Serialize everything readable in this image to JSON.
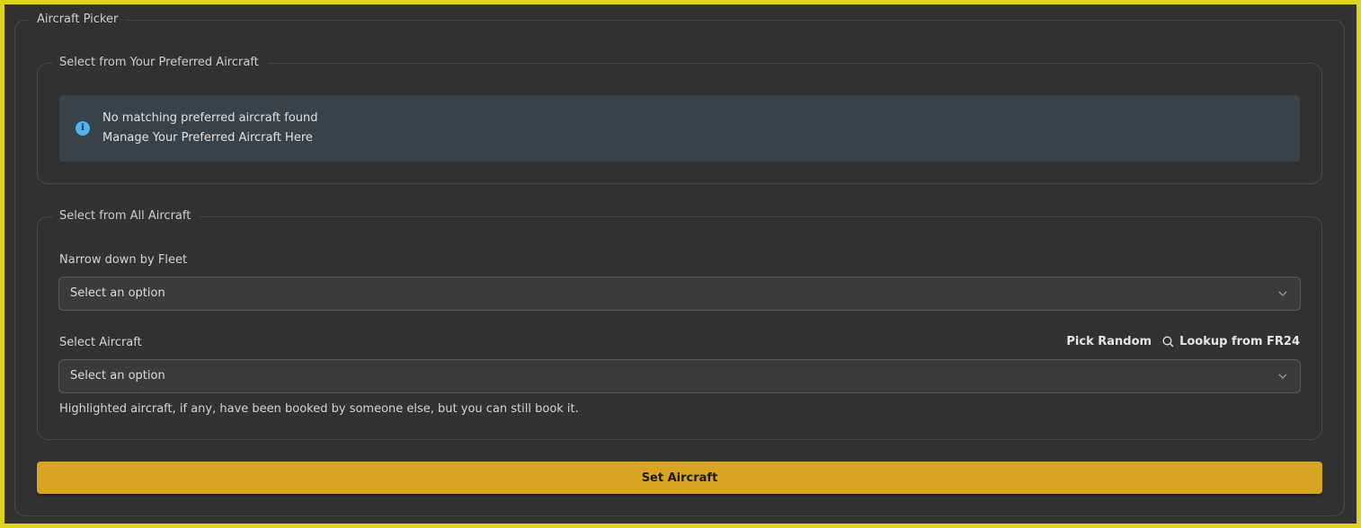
{
  "picker": {
    "legend": "Aircraft Picker"
  },
  "preferred": {
    "legend": "Select from Your Preferred Aircraft",
    "alert_title": "No matching preferred aircraft found",
    "alert_link": "Manage Your Preferred Aircraft Here",
    "alert_icon": "info-icon",
    "alert_icon_glyph": "i"
  },
  "all": {
    "legend": "Select from All Aircraft",
    "fleet_label": "Narrow down by Fleet",
    "fleet_value": "Select an option",
    "aircraft_label": "Select Aircraft",
    "aircraft_value": "Select an option",
    "pick_random": "Pick Random",
    "lookup": "Lookup from FR24",
    "hint": "Highlighted aircraft, if any, have been booked by someone else, but you can still book it."
  },
  "submit": {
    "label": "Set Aircraft"
  },
  "colors": {
    "frame_border": "#dfd21f",
    "background": "#323232",
    "button": "#d9a420",
    "alert_bg": "#37424a",
    "info_icon": "#4fb3ef"
  }
}
